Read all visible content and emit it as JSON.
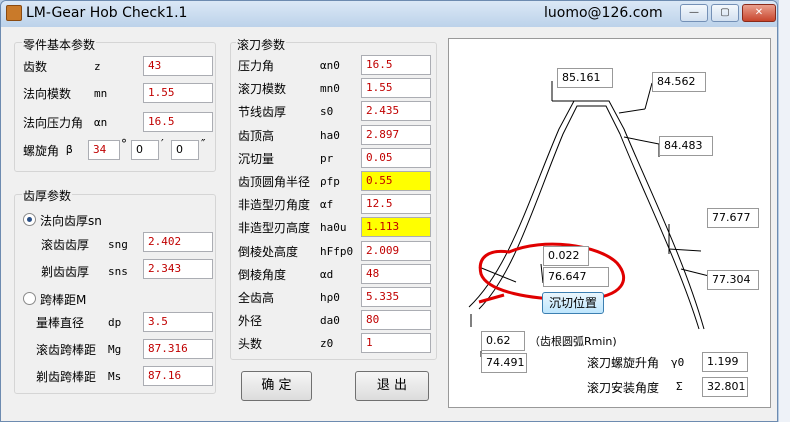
{
  "window": {
    "title": "LM-Gear Hob Check1.1",
    "email": "luomo@126.com",
    "btn_min": "—",
    "btn_max": "▢",
    "btn_close": "✕"
  },
  "part": {
    "title": "零件基本参数",
    "teeth": {
      "label": "齿数",
      "sym": "z",
      "val": "43"
    },
    "module": {
      "label": "法向模数",
      "sym": "mn",
      "val": "1.55"
    },
    "pressure": {
      "label": "法向压力角",
      "sym": "αn",
      "val": "16.5"
    },
    "helix": {
      "label": "螺旋角",
      "sym": "β",
      "deg": "34",
      "deg_u": "°",
      "min": "0",
      "min_u": "′",
      "sec": "0",
      "sec_u": "″"
    }
  },
  "thick": {
    "title": "齿厚参数",
    "r1": "法向齿厚sn",
    "sng": {
      "label": "滚齿齿厚",
      "sym": "sng",
      "val": "2.402"
    },
    "sns": {
      "label": "剃齿齿厚",
      "sym": "sns",
      "val": "2.343"
    },
    "r2": "跨棒距M",
    "dp": {
      "label": "量棒直径",
      "sym": "dp",
      "val": "3.5"
    },
    "mg": {
      "label": "滚齿跨棒距",
      "sym": "Mg",
      "val": "87.316"
    },
    "ms": {
      "label": "剃齿跨棒距",
      "sym": "Ms",
      "val": "87.16"
    }
  },
  "hob": {
    "title": "滚刀参数",
    "rows": [
      {
        "label": "压力角",
        "sym": "αn0",
        "val": "16.5"
      },
      {
        "label": "滚刀模数",
        "sym": "mn0",
        "val": "1.55"
      },
      {
        "label": "节线齿厚",
        "sym": "s0",
        "val": "2.435"
      },
      {
        "label": "齿顶高",
        "sym": "ha0",
        "val": "2.897"
      },
      {
        "label": "沉切量",
        "sym": "pr",
        "val": "0.05"
      },
      {
        "label": "齿顶圆角半径",
        "sym": "ρfp",
        "val": "0.55"
      },
      {
        "label": "非造型刃角度",
        "sym": "αf",
        "val": "12.5"
      },
      {
        "label": "非造型刃高度",
        "sym": "ha0u",
        "val": "1.113"
      },
      {
        "label": "倒棱处高度",
        "sym": "hFfp0",
        "val": "2.009"
      },
      {
        "label": "倒棱角度",
        "sym": "αd",
        "val": "48"
      },
      {
        "label": "全齿高",
        "sym": "hρ0",
        "val": "5.335"
      },
      {
        "label": "外径",
        "sym": "da0",
        "val": "80"
      },
      {
        "label": "头数",
        "sym": "z0",
        "val": "1"
      }
    ]
  },
  "buttons": {
    "ok": "确  定",
    "exit": "退  出"
  },
  "drawing": {
    "top": "85.161",
    "r1": "84.562",
    "r2": "84.483",
    "r3": "77.677",
    "r4": "77.304",
    "c1": "0.022",
    "c2": "76.647",
    "sink_btn": "沉切位置",
    "rmin": "0.62",
    "rmin_note": "（齿根圆弧Rmin)",
    "root": "74.491",
    "lead_label": "滚刀螺旋升角",
    "lead_sym": "γ0",
    "lead_val": "1.199",
    "inst_label": "滚刀安装角度",
    "inst_sym": "Σ",
    "inst_val": "32.801"
  },
  "colors": {
    "value_text": "#c00000",
    "highlight": "#ffff00",
    "annotation": "#e00000"
  }
}
